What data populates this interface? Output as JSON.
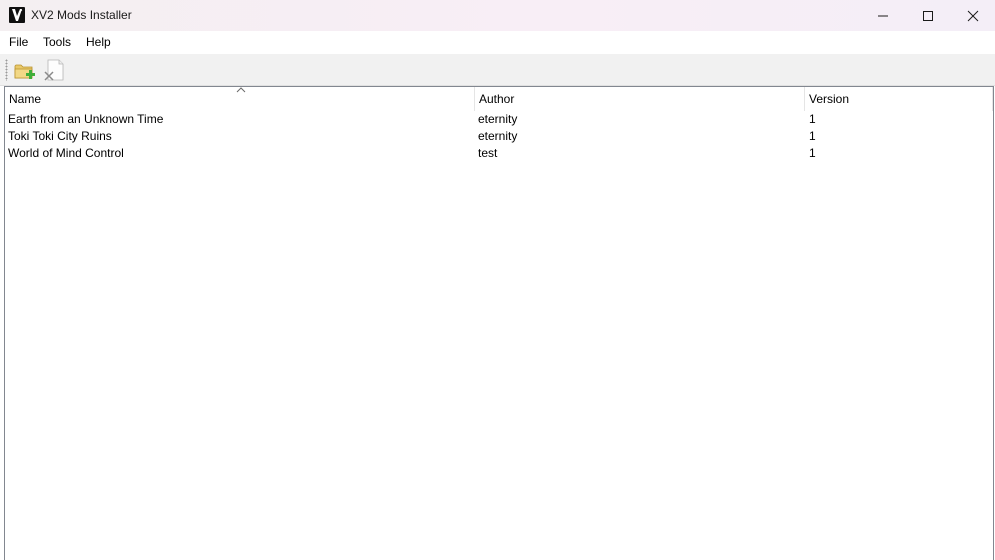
{
  "window": {
    "title": "XV2 Mods Installer"
  },
  "menu": {
    "file": "File",
    "tools": "Tools",
    "help": "Help"
  },
  "toolbar": {
    "install_icon": "folder-add-icon",
    "uninstall_icon": "document-remove-icon"
  },
  "list": {
    "columns": [
      "Name",
      "Author",
      "Version"
    ],
    "sort_column": "Name",
    "rows": [
      {
        "name": "Earth from an Unknown Time",
        "author": "eternity",
        "version": "1"
      },
      {
        "name": "Toki Toki City Ruins",
        "author": "eternity",
        "version": "1"
      },
      {
        "name": "World of Mind Control",
        "author": "test",
        "version": "1"
      }
    ]
  },
  "colors": {
    "titlebar": "#f6eef5",
    "toolbar": "#f1f1f1",
    "list_border": "#828790"
  }
}
